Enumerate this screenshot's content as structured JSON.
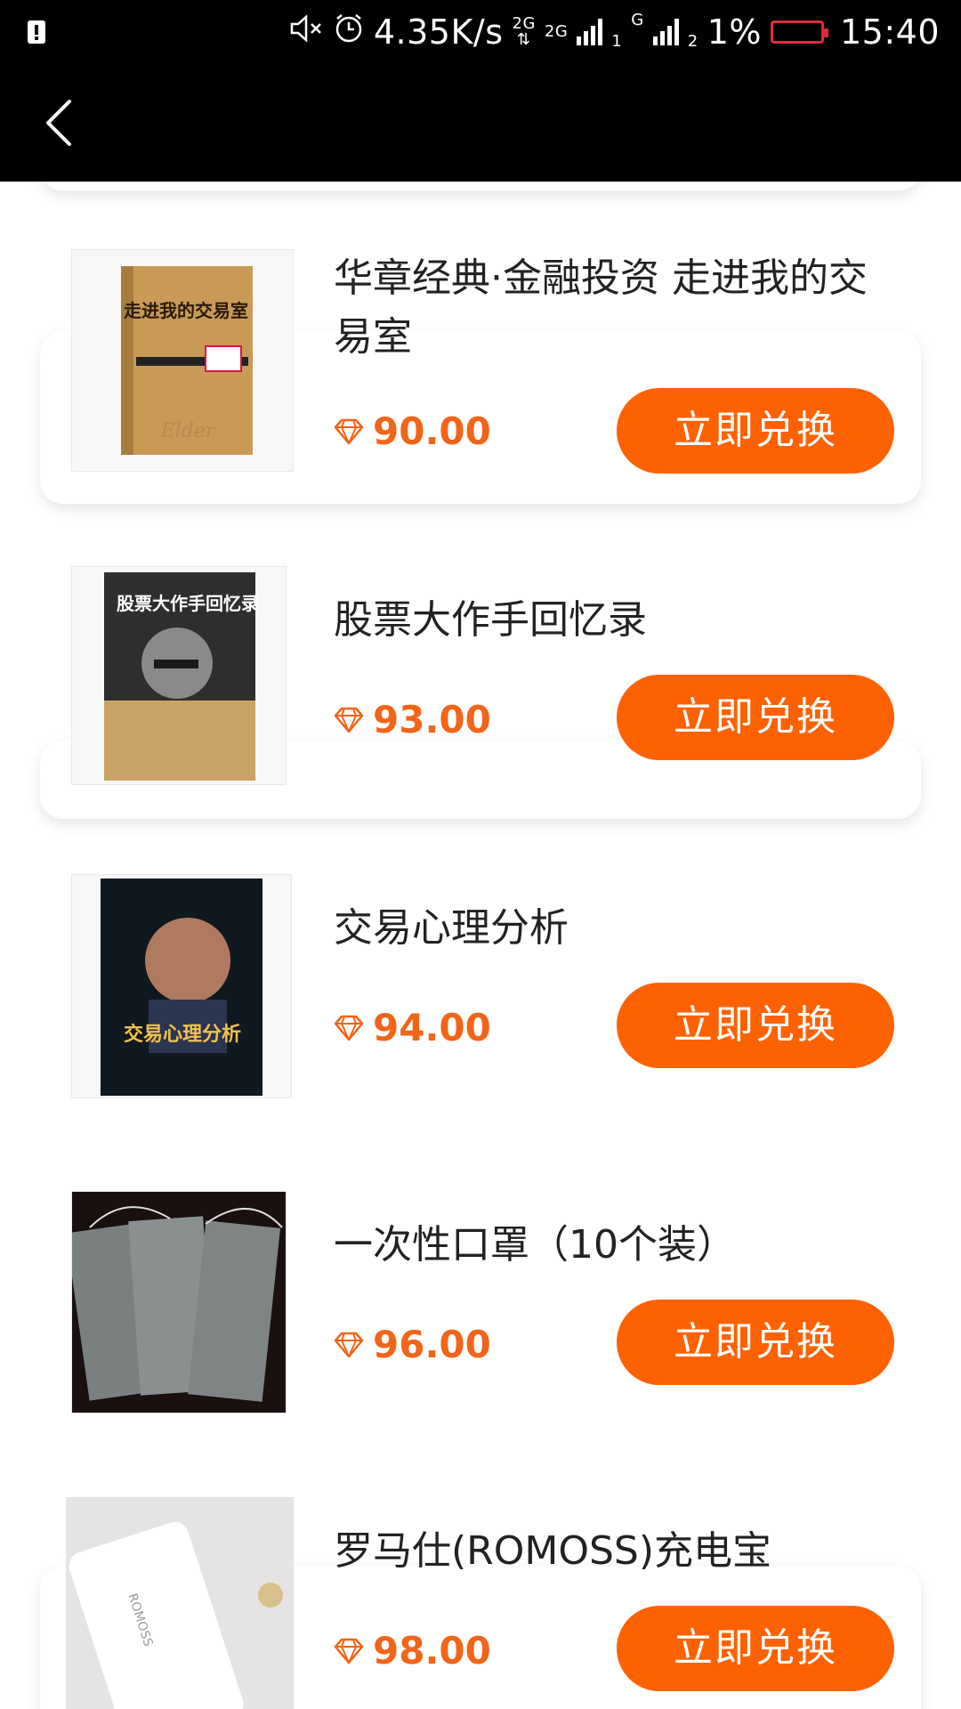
{
  "status_bar": {
    "net_speed": "4.35K/s",
    "network_label_1": "2G",
    "network_label_2": "2G",
    "sim1": "1",
    "sim2": "2",
    "g_label": "G",
    "battery_percent": "1%",
    "time": "15:40",
    "battery_color": "#e02b3a"
  },
  "nav": {
    "back_icon": "chevron-left-icon"
  },
  "colors": {
    "accent": "#fe6100",
    "price": "#f26418"
  },
  "products": [
    {
      "title": "华章经典·金融投资 走进我的交易室",
      "price": "90.00",
      "button": "立即兑换",
      "image_label": "book-cover-trading-room"
    },
    {
      "title": "股票大作手回忆录",
      "price": "93.00",
      "button": "立即兑换",
      "image_label": "book-cover-stock-operator"
    },
    {
      "title": "交易心理分析",
      "price": "94.00",
      "button": "立即兑换",
      "image_label": "book-cover-trading-psychology"
    },
    {
      "title": "一次性口罩（10个装）",
      "price": "96.00",
      "button": "立即兑换",
      "image_label": "masks-photo"
    },
    {
      "title": "罗马仕(ROMOSS)充电宝",
      "price": "98.00",
      "button": "立即兑换",
      "image_label": "power-bank-photo"
    }
  ],
  "book_covers": {
    "cover1_title": "走进我的交易室",
    "cover2_title": "股票大作手回忆录",
    "cover3_title": "交易心理分析",
    "powerbank_brand": "ROMOSS"
  }
}
